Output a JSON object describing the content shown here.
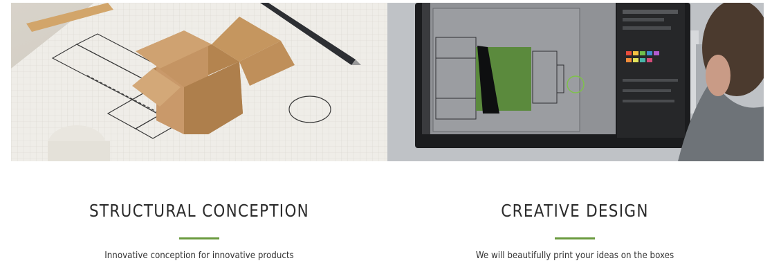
{
  "features": [
    {
      "title": "STRUCTURAL CONCEPTION",
      "text": "Innovative conception for innovative products"
    },
    {
      "title": "CREATIVE DESIGN",
      "text": "We will beautifully print your ideas on the boxes"
    }
  ],
  "colors": {
    "accent": "#6a9a3e",
    "heading": "#2b2b2b",
    "body_text": "#333333"
  }
}
